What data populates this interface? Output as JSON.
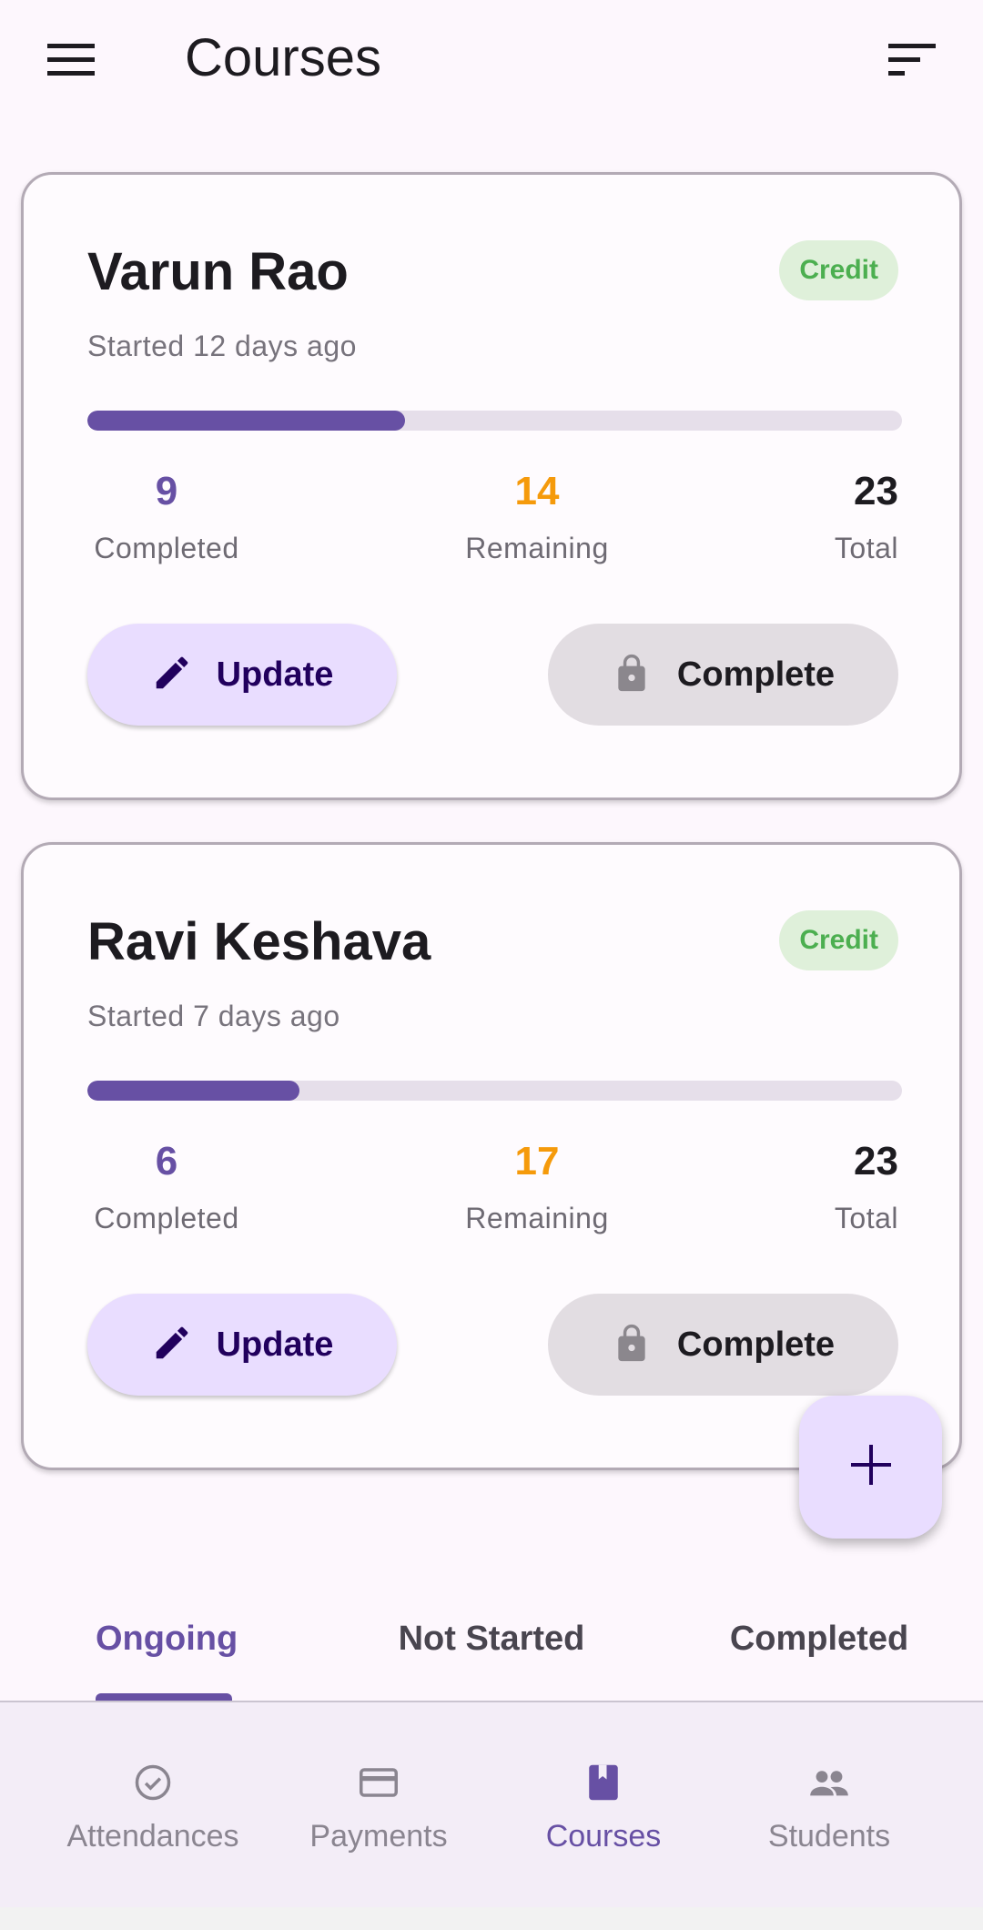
{
  "header": {
    "title": "Courses",
    "menu_icon": "menu-icon",
    "sort_icon": "sort-icon"
  },
  "courses": [
    {
      "name": "Varun Rao",
      "badge": "Credit",
      "started": "Started 12 days ago",
      "progress": 0.39,
      "completed_value": "9",
      "completed_label": "Completed",
      "remaining_value": "14",
      "remaining_label": "Remaining",
      "total_value": "23",
      "total_label": "Total",
      "update_label": "Update",
      "complete_label": "Complete"
    },
    {
      "name": "Ravi Keshava",
      "badge": "Credit",
      "started": "Started 7 days ago",
      "progress": 0.26,
      "completed_value": "6",
      "completed_label": "Completed",
      "remaining_value": "17",
      "remaining_label": "Remaining",
      "total_value": "23",
      "total_label": "Total",
      "update_label": "Update",
      "complete_label": "Complete"
    }
  ],
  "fab": {
    "icon": "plus-icon"
  },
  "tabs": [
    {
      "label": "Ongoing",
      "active": true
    },
    {
      "label": "Not Started",
      "active": false
    },
    {
      "label": "Completed",
      "active": false
    }
  ],
  "bottom_nav": [
    {
      "label": "Attendances",
      "icon": "check-circle-icon",
      "active": false
    },
    {
      "label": "Payments",
      "icon": "credit-card-icon",
      "active": false
    },
    {
      "label": "Courses",
      "icon": "book-icon",
      "active": true
    },
    {
      "label": "Students",
      "icon": "people-icon",
      "active": false
    }
  ],
  "colors": {
    "accent": "#6750a4",
    "remaining": "#f59a0b",
    "badge_text": "#4caf50",
    "badge_bg": "#dff0da"
  }
}
